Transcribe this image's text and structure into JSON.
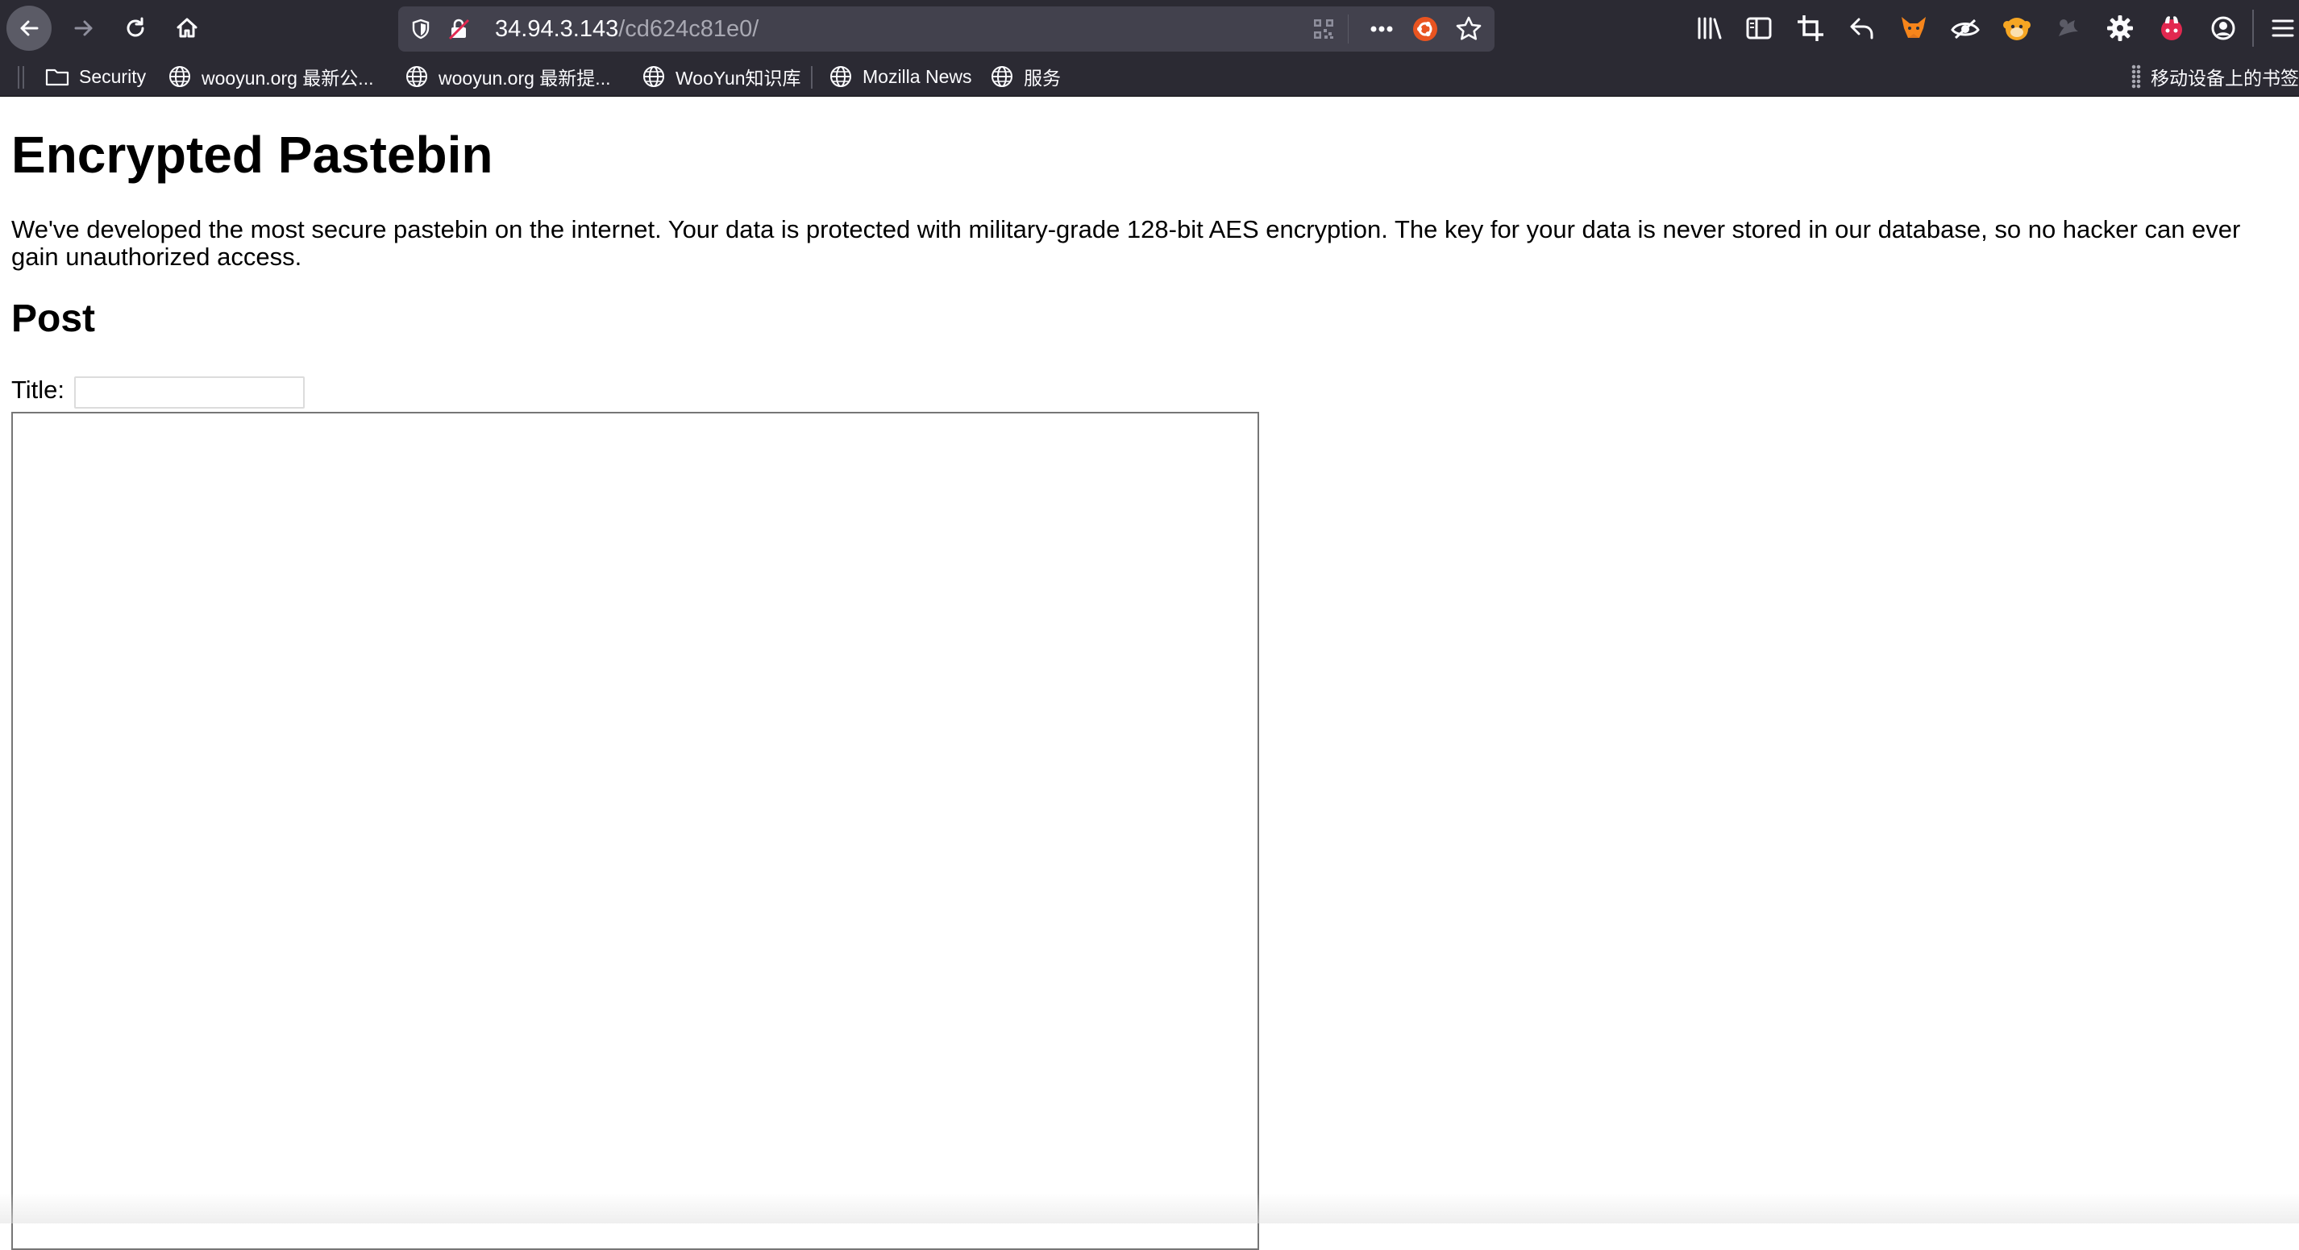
{
  "browser": {
    "url_host": "34.94.3.143",
    "url_path": "/cd624c81e0/",
    "toolbar_icons": [
      "library-icon",
      "sidebar-icon",
      "crop-icon",
      "undo-icon",
      "fox-extension-icon",
      "eye-extension-icon",
      "monkey-extension-icon",
      "grey-extension-icon",
      "gear-icon",
      "rabbit-extension-icon",
      "account-icon",
      "menu-icon"
    ]
  },
  "bookmarks": {
    "items": [
      {
        "label": "Security",
        "icon": "folder-icon"
      },
      {
        "label": "wooyun.org 最新公...",
        "icon": "globe-icon"
      },
      {
        "label": "wooyun.org 最新提...",
        "icon": "globe-icon"
      },
      {
        "label": "WooYun知识库",
        "icon": "globe-icon"
      },
      {
        "label": "Mozilla News",
        "icon": "globe-icon"
      },
      {
        "label": "服务",
        "icon": "globe-icon"
      }
    ],
    "mobile_label": "移动设备上的书签"
  },
  "page": {
    "title": "Encrypted Pastebin",
    "intro": "We've developed the most secure pastebin on the internet. Your data is protected with military-grade 128-bit AES encryption. The key for your data is never stored in our database, so no hacker can ever gain unauthorized access.",
    "post_heading": "Post",
    "title_label": "Title:",
    "title_value": "",
    "content_value": ""
  }
}
